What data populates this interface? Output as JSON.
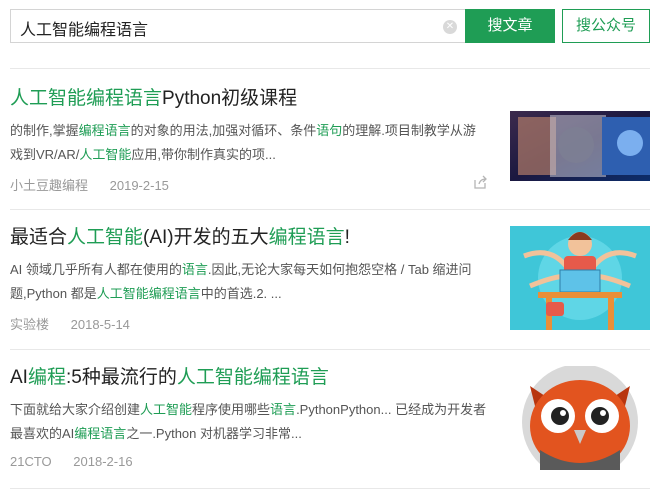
{
  "search": {
    "query": "人工智能编程语言",
    "clear_icon": "clear-icon"
  },
  "buttons": {
    "article": "搜文章",
    "account": "搜公众号"
  },
  "results": [
    {
      "title": [
        {
          "t": "人工智能编程语言",
          "hl": true
        },
        {
          "t": "Python初级课程",
          "hl": false
        }
      ],
      "snippet": [
        {
          "t": "的制作,掌握",
          "hl": false
        },
        {
          "t": "编程语言",
          "hl": true
        },
        {
          "t": "的对象的用法,加强对循环、条件",
          "hl": false
        },
        {
          "t": "语句",
          "hl": true
        },
        {
          "t": "的理解.项目制教学从游戏到VR/AR/",
          "hl": false
        },
        {
          "t": "人工智能",
          "hl": true
        },
        {
          "t": "应用,带你制作真实的项...",
          "hl": false
        }
      ],
      "source": "小土豆趣编程",
      "date": "2019-2-15",
      "has_share": true
    },
    {
      "title": [
        {
          "t": "最适合",
          "hl": false
        },
        {
          "t": "人工智能",
          "hl": true
        },
        {
          "t": "(AI)开发的五大",
          "hl": false
        },
        {
          "t": "编程语言",
          "hl": true
        },
        {
          "t": "!",
          "hl": false
        }
      ],
      "snippet": [
        {
          "t": "AI 领域几乎所有人都在使用的",
          "hl": false
        },
        {
          "t": "语言",
          "hl": true
        },
        {
          "t": ".因此,无论大家每天如何抱怨空格 / Tab 缩进问题,Python 都是",
          "hl": false
        },
        {
          "t": "人工智能编程语言",
          "hl": true
        },
        {
          "t": "中的首选.2. ...",
          "hl": false
        }
      ],
      "source": "实验楼",
      "date": "2018-5-14",
      "has_share": false
    },
    {
      "title": [
        {
          "t": "AI",
          "hl": false
        },
        {
          "t": "编程",
          "hl": true
        },
        {
          "t": ":5种最流行的",
          "hl": false
        },
        {
          "t": "人工智能编程语言",
          "hl": true
        }
      ],
      "snippet": [
        {
          "t": "下面就给大家介绍创建",
          "hl": false
        },
        {
          "t": "人工智能",
          "hl": true
        },
        {
          "t": "程序使用哪些",
          "hl": false
        },
        {
          "t": "语言",
          "hl": true
        },
        {
          "t": ".PythonPython... 已经成为开发者最喜欢的AI",
          "hl": false
        },
        {
          "t": "编程语言",
          "hl": true
        },
        {
          "t": "之一.Python 对机器学习非常...",
          "hl": false
        }
      ],
      "source": "21CTO",
      "date": "2018-2-16",
      "has_share": false
    }
  ]
}
